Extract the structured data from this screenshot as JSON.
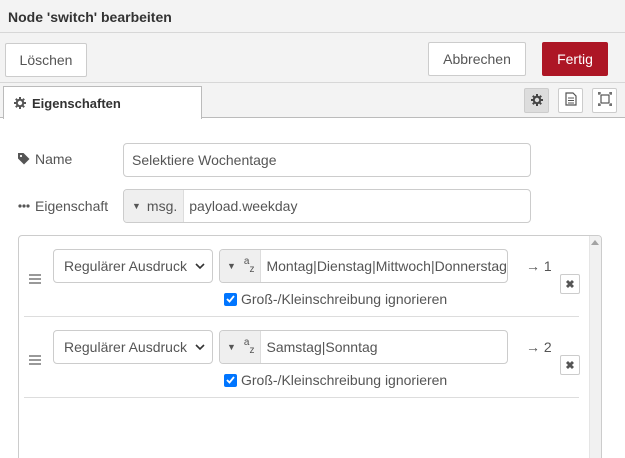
{
  "titlebar": {
    "title": "Node 'switch' bearbeiten"
  },
  "toolbar": {
    "delete_label": "Löschen",
    "cancel_label": "Abbrechen",
    "done_label": "Fertig",
    "done_color": "#ad1625"
  },
  "tabs": {
    "properties_label": "Eigenschaften",
    "properties_icon": "gear-icon",
    "icons": [
      "gear-icon",
      "document-icon",
      "frame-icon"
    ]
  },
  "form": {
    "name_label": "Name",
    "name_icon": "tag-icon",
    "name_value": "Selektiere Wochentage",
    "property_label": "Eigenschaft",
    "property_icon": "ellipsis-icon",
    "property_type": "msg.",
    "property_value": "payload.weekday"
  },
  "rules": [
    {
      "operator": "Regulärer Ausdruck",
      "type_icon": "az-icon",
      "value": "Montag|Dienstag|Mittwoch|Donnerstag|",
      "output": "→ 1",
      "ignore_case_label": "Groß-/Kleinschreibung ignorieren",
      "ignore_case": true
    },
    {
      "operator": "Regulärer Ausdruck",
      "type_icon": "az-icon",
      "value": "Samstag|Sonntag",
      "output": "→ 2",
      "ignore_case_label": "Groß-/Kleinschreibung ignorieren",
      "ignore_case": true
    }
  ]
}
